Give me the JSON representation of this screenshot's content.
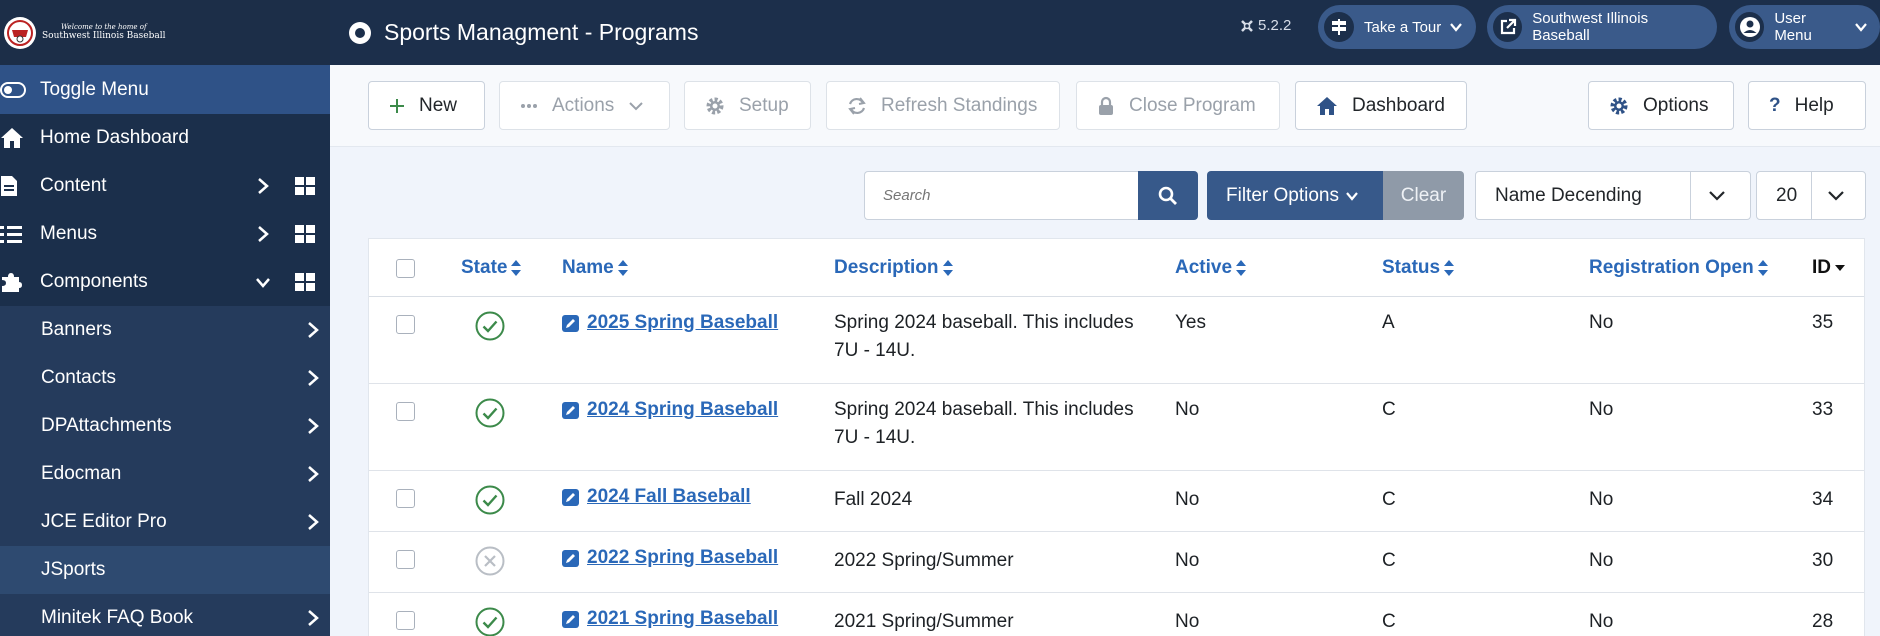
{
  "brand": {
    "line1": "Welcome to the home of",
    "line2": "Southwest Illinois Baseball"
  },
  "sidebar": {
    "toggle_label": "Toggle Menu",
    "items": [
      {
        "label": "Home Dashboard",
        "icon": "home-icon"
      },
      {
        "label": "Content",
        "icon": "document-icon"
      },
      {
        "label": "Menus",
        "icon": "list-icon"
      },
      {
        "label": "Components",
        "icon": "puzzle-icon"
      }
    ],
    "sub_items": [
      {
        "label": "Banners"
      },
      {
        "label": "Contacts"
      },
      {
        "label": "DPAttachments"
      },
      {
        "label": "Edocman"
      },
      {
        "label": "JCE Editor Pro"
      },
      {
        "label": "JSports"
      },
      {
        "label": "Minitek FAQ Book"
      }
    ]
  },
  "header": {
    "title": "Sports Managment - Programs",
    "version": "5.2.2",
    "tour_label": "Take a Tour",
    "site_label": "Southwest Illinois Baseball",
    "user_label": "User Menu"
  },
  "toolbar": {
    "new_label": "New",
    "actions_label": "Actions",
    "setup_label": "Setup",
    "refresh_label": "Refresh Standings",
    "close_label": "Close Program",
    "dashboard_label": "Dashboard",
    "options_label": "Options",
    "help_label": "Help"
  },
  "filters": {
    "search_placeholder": "Search",
    "filter_options_label": "Filter Options",
    "clear_label": "Clear",
    "sort_value": "Name Decending",
    "limit_value": "20"
  },
  "table": {
    "headers": {
      "state": "State",
      "name": "Name",
      "description": "Description",
      "active": "Active",
      "status": "Status",
      "registration": "Registration Open",
      "id": "ID"
    },
    "rows": [
      {
        "published": true,
        "name": "2025 Spring Baseball",
        "desc1": "Spring 2024 baseball. This includes",
        "desc2": "7U - 14U.",
        "active": "Yes",
        "status": "A",
        "registration": "No",
        "id": "35"
      },
      {
        "published": true,
        "name": "2024 Spring Baseball",
        "desc1": "Spring 2024 baseball. This includes",
        "desc2": "7U - 14U.",
        "active": "No",
        "status": "C",
        "registration": "No",
        "id": "33"
      },
      {
        "published": true,
        "name": "2024 Fall Baseball",
        "desc1": "Fall 2024",
        "desc2": "",
        "active": "No",
        "status": "C",
        "registration": "No",
        "id": "34"
      },
      {
        "published": false,
        "name": "2022 Spring Baseball",
        "desc1": "2022 Spring/Summer",
        "desc2": "",
        "active": "No",
        "status": "C",
        "registration": "No",
        "id": "30"
      },
      {
        "published": true,
        "name": "2021 Spring Baseball",
        "desc1": "2021 Spring/Summer",
        "desc2": "",
        "active": "No",
        "status": "C",
        "registration": "No",
        "id": "28"
      }
    ]
  },
  "colors": {
    "sidebar_bg": "#1b2f4b",
    "accent": "#37598a",
    "link": "#2a68b8",
    "published_green": "#3c8a4a"
  }
}
